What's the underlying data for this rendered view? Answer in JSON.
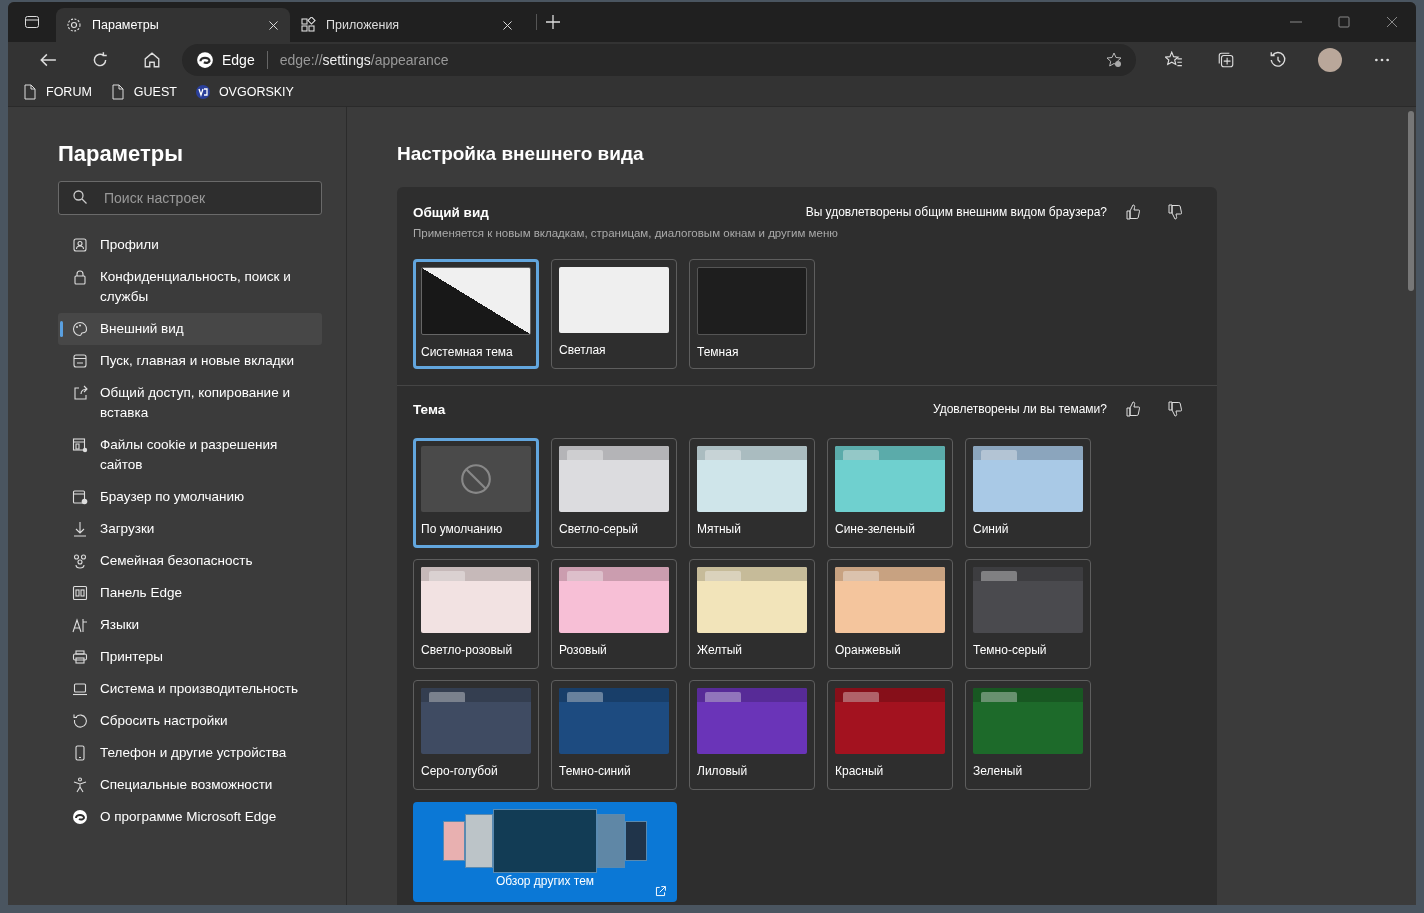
{
  "tabs": [
    {
      "title": "Параметры",
      "selected": true
    },
    {
      "title": "Приложения",
      "selected": false
    }
  ],
  "address": {
    "site": "Edge",
    "url_prefix": "edge://",
    "url_host": "settings",
    "url_path": "/appearance"
  },
  "bookmarks": [
    {
      "label": "FORUM",
      "kind": "page"
    },
    {
      "label": "GUEST",
      "kind": "page"
    },
    {
      "label": "OVGORSKIY",
      "kind": "logo"
    }
  ],
  "sidebar": {
    "title": "Параметры",
    "search": {
      "placeholder": "Поиск настроек"
    },
    "items": [
      {
        "label": "Профили",
        "selected": false
      },
      {
        "label": "Конфиденциальность, поиск и службы",
        "selected": false
      },
      {
        "label": "Внешний вид",
        "selected": true
      },
      {
        "label": "Пуск, главная и новые вкладки",
        "selected": false
      },
      {
        "label": "Общий доступ, копирование и вставка",
        "selected": false
      },
      {
        "label": "Файлы cookie и разрешения сайтов",
        "selected": false
      },
      {
        "label": "Браузер по умолчанию",
        "selected": false
      },
      {
        "label": "Загрузки",
        "selected": false
      },
      {
        "label": "Семейная безопасность",
        "selected": false
      },
      {
        "label": "Панель Edge",
        "selected": false
      },
      {
        "label": "Языки",
        "selected": false
      },
      {
        "label": "Принтеры",
        "selected": false
      },
      {
        "label": "Система и производительность",
        "selected": false
      },
      {
        "label": "Сбросить настройки",
        "selected": false
      },
      {
        "label": "Телефон и другие устройства",
        "selected": false
      },
      {
        "label": "Специальные возможности",
        "selected": false
      },
      {
        "label": "О программе Microsoft Edge",
        "selected": false
      }
    ]
  },
  "page_title": "Настройка внешнего вида",
  "general": {
    "title": "Общий вид",
    "question": "Вы удовлетворены общим внешним видом браузера?",
    "description": "Применяется к новым вкладкам, страницам, диалоговым окнам и другим меню",
    "options": [
      {
        "label": "Системная тема",
        "kind": "system",
        "selected": true
      },
      {
        "label": "Светлая",
        "kind": "light",
        "selected": false
      },
      {
        "label": "Темная",
        "kind": "dark",
        "selected": false
      }
    ]
  },
  "theme": {
    "title": "Тема",
    "question": "Удовлетворены ли вы темами?",
    "themes": [
      {
        "label": "По умолчанию",
        "kind": "none",
        "selected": true
      },
      {
        "label": "Светло-серый",
        "kind": "folder",
        "color": "#dcdcdf",
        "selected": false
      },
      {
        "label": "Мятный",
        "kind": "folder",
        "color": "#cfe5ea",
        "selected": false
      },
      {
        "label": "Сине-зеленый",
        "kind": "folder",
        "color": "#6fd0cf",
        "selected": false
      },
      {
        "label": "Синий",
        "kind": "folder",
        "color": "#a9c9e6",
        "selected": false
      },
      {
        "label": "Светло-розовый",
        "kind": "folder",
        "color": "#f2e2e2",
        "selected": false
      },
      {
        "label": "Розовый",
        "kind": "folder",
        "color": "#f7bfd6",
        "selected": false
      },
      {
        "label": "Желтый",
        "kind": "folder",
        "color": "#f2e4ba",
        "selected": false
      },
      {
        "label": "Оранжевый",
        "kind": "folder",
        "color": "#f4c59d",
        "selected": false
      },
      {
        "label": "Темно-серый",
        "kind": "folder",
        "color": "#4a4a4e",
        "selected": false
      },
      {
        "label": "Серо-голубой",
        "kind": "folder",
        "color": "#3f4b62",
        "selected": false
      },
      {
        "label": "Темно-синий",
        "kind": "folder",
        "color": "#1d4b80",
        "selected": false
      },
      {
        "label": "Лиловый",
        "kind": "folder",
        "color": "#6a34b8",
        "selected": false
      },
      {
        "label": "Красный",
        "kind": "folder",
        "color": "#a3121f",
        "selected": false
      },
      {
        "label": "Зеленый",
        "kind": "folder",
        "color": "#1d6a2a",
        "selected": false
      }
    ],
    "more_label": "Обзор других тем"
  }
}
